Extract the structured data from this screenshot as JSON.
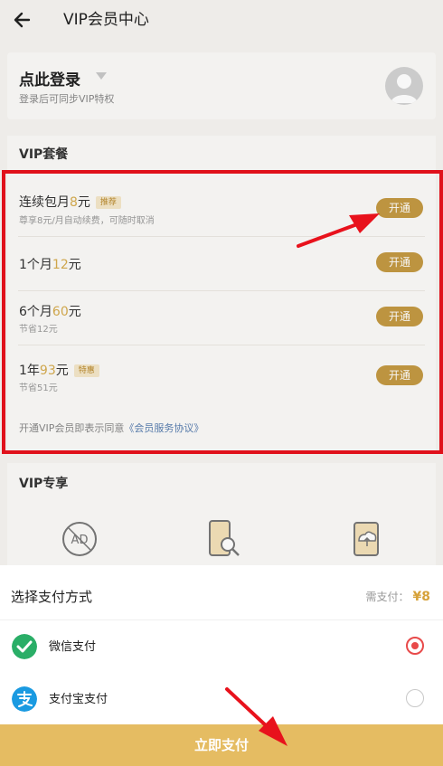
{
  "header": {
    "title": "VIP会员中心",
    "back_icon": "arrow-left-icon"
  },
  "login": {
    "title": "点此登录",
    "subtitle": "登录后可同步VIP特权",
    "avatar_icon": "user-avatar-icon"
  },
  "packages": {
    "section_title": "VIP套餐",
    "items": [
      {
        "name_prefix": "连续包月",
        "price": "8",
        "name_suffix": "元",
        "tag": "推荐",
        "subtitle": "尊享8元/月自动续费，可随时取消",
        "button": "开通"
      },
      {
        "name_prefix": "1个月",
        "price": "12",
        "name_suffix": "元",
        "tag": "",
        "subtitle": "",
        "button": "开通"
      },
      {
        "name_prefix": "6个月",
        "price": "60",
        "name_suffix": "元",
        "tag": "",
        "subtitle": "节省12元",
        "button": "开通"
      },
      {
        "name_prefix": "1年",
        "price": "93",
        "name_suffix": "元",
        "tag": "特惠",
        "subtitle": "节省51元",
        "button": "开通"
      }
    ],
    "agreement_prefix": "开通VIP会员即表示同意",
    "agreement_link": "《会员服务协议》"
  },
  "exclusive": {
    "section_title": "VIP专享",
    "icons": [
      "no-ads-icon",
      "phone-search-icon",
      "cloud-upload-icon"
    ]
  },
  "payment": {
    "title": "选择支付方式",
    "need_pay_label": "需支付：",
    "amount": "¥8",
    "methods": [
      {
        "label": "微信支付",
        "icon": "wechat-pay-icon",
        "selected": true
      },
      {
        "label": "支付宝支付",
        "icon": "alipay-icon",
        "selected": false
      }
    ],
    "pay_button": "立即支付"
  },
  "colors": {
    "gold": "#c49943",
    "price": "#d6ac4f",
    "pay_button": "#e5bc62",
    "highlight_red": "#e8121c",
    "wechat": "#2aae67",
    "alipay": "#1a9ae1"
  }
}
